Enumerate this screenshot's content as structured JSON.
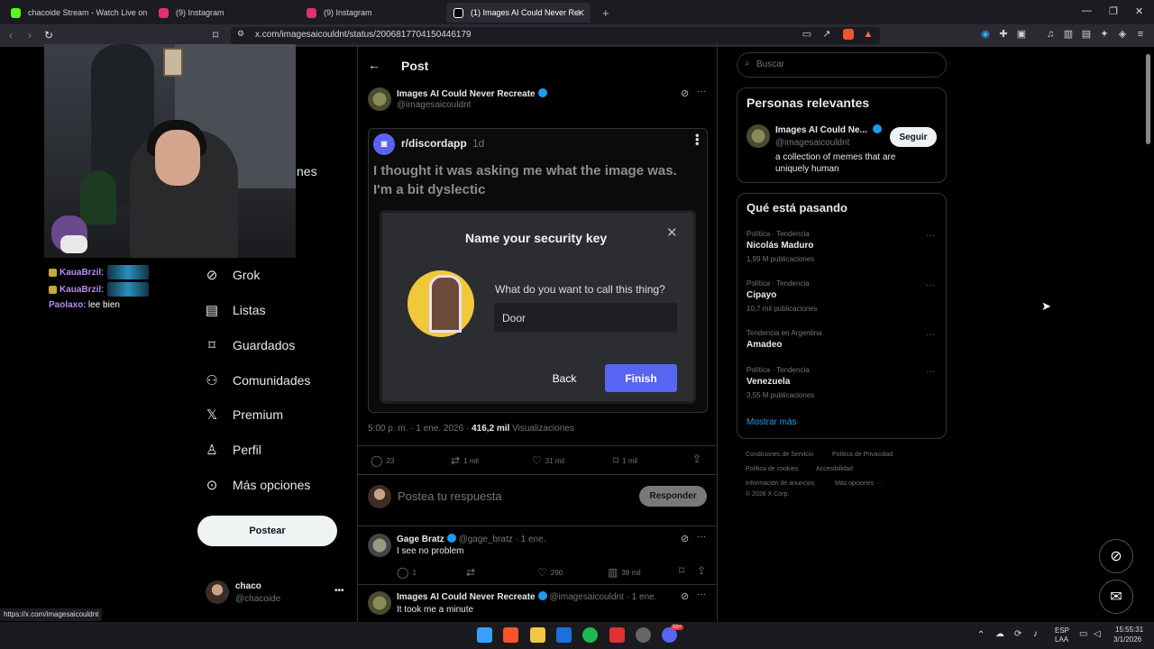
{
  "browser": {
    "tabs": [
      {
        "label": "chacoide Stream - Watch Live on",
        "color": "#53fc18"
      },
      {
        "label": "(9) Instagram",
        "color": "#e1306c"
      },
      {
        "label": "(9) Instagram",
        "color": "#e1306c"
      },
      {
        "label": "(1) Images AI Could Never Recre",
        "color": "#ffffff"
      }
    ],
    "url": "x.com/imagesaicouldnt/status/2006817704150446179",
    "status_url": "https://x.com/imagesaicouldnt"
  },
  "stream": {
    "chat": [
      {
        "user": "KauaBrzil",
        "text": ":"
      },
      {
        "user": "KauaBrzil",
        "text": ":"
      },
      {
        "user": "Paolaxo",
        "text": ": lee bien"
      }
    ],
    "overlay_text": "nes"
  },
  "nav": {
    "items": [
      {
        "label": "Grok",
        "icon": "grok-icon"
      },
      {
        "label": "Listas",
        "icon": "list-icon"
      },
      {
        "label": "Guardados",
        "icon": "bookmark-icon"
      },
      {
        "label": "Comunidades",
        "icon": "communities-icon"
      },
      {
        "label": "Premium",
        "icon": "x-logo-icon"
      },
      {
        "label": "Perfil",
        "icon": "profile-icon"
      },
      {
        "label": "Más opciones",
        "icon": "more-options-icon"
      }
    ],
    "post_button": "Postear",
    "account": {
      "name": "chaco",
      "handle": "@chacoide"
    }
  },
  "post": {
    "header": "Post",
    "author": "Images AI Could Never Recreate",
    "handle": "@imagesaicouldnt",
    "embed": {
      "community": "r/discordapp",
      "age": "1d",
      "text": "I thought it was asking me what the image was. I'm a bit dyslectic",
      "dialog_title": "Name your security key",
      "dialog_question": "What do you want to call this thing?",
      "dialog_value": "Door",
      "back": "Back",
      "finish": "Finish"
    },
    "timestamp": "5:00 p. m. · 1 ene. 2026 · ",
    "views_count": "416,2 mil",
    "views_label": "Visualizaciones",
    "stats": {
      "replies": "23",
      "reposts": "1 mil",
      "likes": "31 mil",
      "bookmarks": "1 mil"
    },
    "reply_placeholder": "Postea tu respuesta",
    "reply_button": "Responder"
  },
  "replies": [
    {
      "name": "Gage Bratz",
      "handle": "@gage_bratz · 1 ene.",
      "text": "I see no problem",
      "replies": "1",
      "likes": "290",
      "views": "39 mil"
    },
    {
      "name": "Images AI Could Never Recreate",
      "handle": "@imagesaicouldnt · 1 ene.",
      "text": "It took me a minute"
    }
  ],
  "right": {
    "search_placeholder": "Buscar",
    "relevant_title": "Personas relevantes",
    "relevant": {
      "name": "Images AI Could Ne...",
      "handle": "@imagesaicouldnt",
      "bio": "a collection of memes that are uniquely human",
      "follow": "Seguir"
    },
    "trending_title": "Qué está pasando",
    "trends": [
      {
        "meta": "Política · Tendencia",
        "name": "Nicolás Maduro",
        "count": "1,99 M publicaciones"
      },
      {
        "meta": "Política · Tendencia",
        "name": "Cipayo",
        "count": "10,7 mil publicaciones"
      },
      {
        "meta": "Tendencia en Argentina",
        "name": "Amadeo",
        "count": ""
      },
      {
        "meta": "Política · Tendencia",
        "name": "Venezuela",
        "count": "3,55 M publicaciones"
      }
    ],
    "show_more": "Mostrar más",
    "footer": [
      "Condiciones de Servicio",
      "Política de Privacidad",
      "Política de cookies",
      "Accesibilidad",
      "Información de anuncios",
      "Más opciones ···",
      "© 2026 X Corp."
    ]
  },
  "taskbar": {
    "lang1": "ESP",
    "lang2": "LAA",
    "time": "15:55:31",
    "date": "3/1/2026",
    "notif": "99+"
  }
}
